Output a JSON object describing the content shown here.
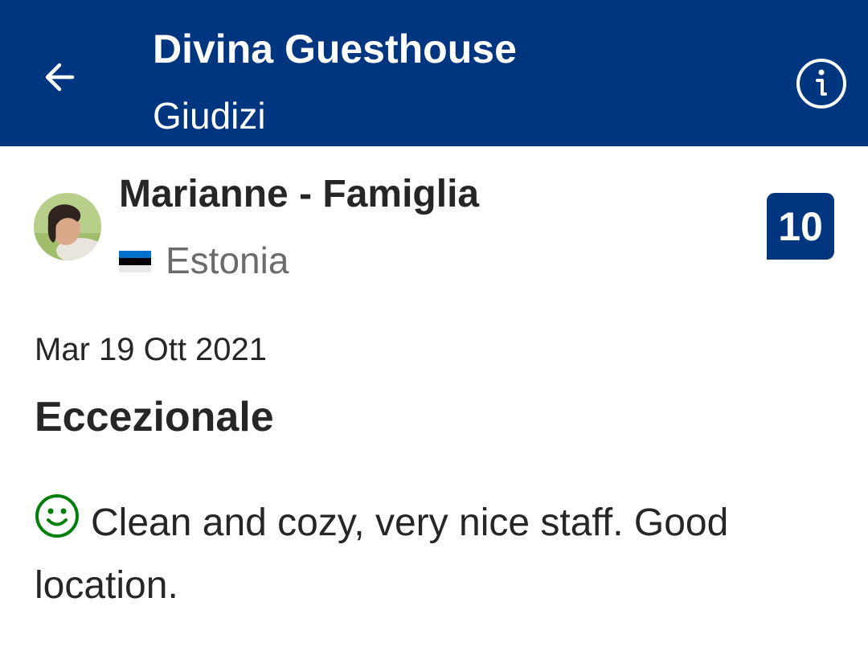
{
  "header": {
    "title": "Divina Guesthouse",
    "subtitle": "Giudizi",
    "back_icon": "arrow-left-icon",
    "info_icon": "info-icon",
    "background_color": "#003580"
  },
  "review": {
    "reviewer_name": "Marianne - Famiglia",
    "country": "Estonia",
    "country_flag": "estonia-flag-icon",
    "score": "10",
    "date": "Mar 19 Ott 2021",
    "headline": "Eccezionale",
    "positive_icon": "smile-icon",
    "positive_text": "Clean and cozy, very nice staff. Good location.",
    "positive_color": "#008009"
  }
}
